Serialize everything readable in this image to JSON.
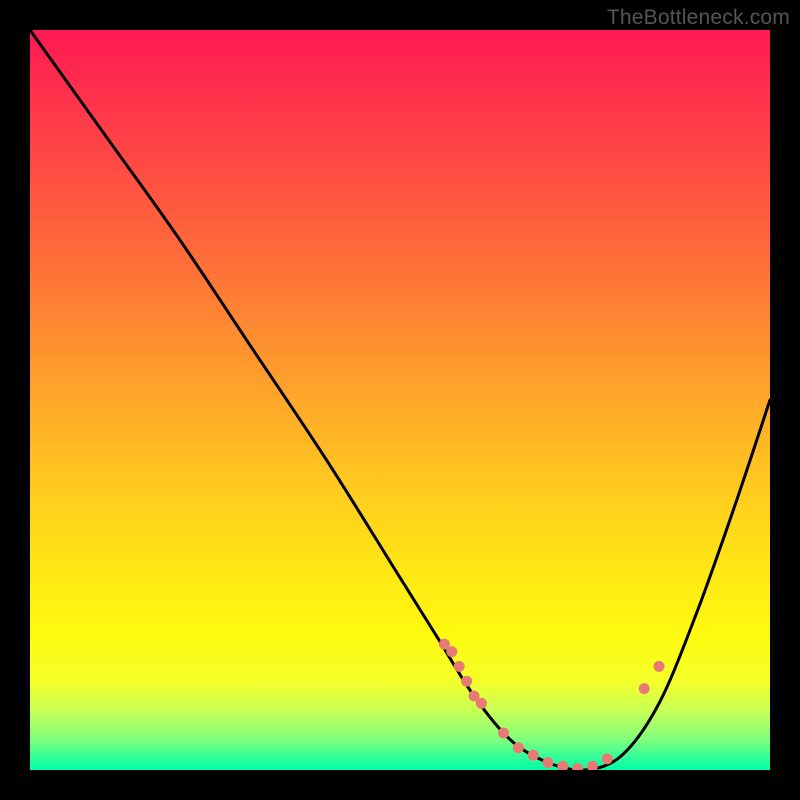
{
  "attribution": "TheBottleneck.com",
  "chart_data": {
    "type": "line",
    "title": "",
    "xlabel": "",
    "ylabel": "",
    "xlim": [
      0,
      100
    ],
    "ylim": [
      0,
      100
    ],
    "series": [
      {
        "name": "bottleneck-curve",
        "x": [
          0,
          10,
          20,
          30,
          40,
          50,
          55,
          60,
          65,
          70,
          75,
          80,
          85,
          90,
          95,
          100
        ],
        "values": [
          100,
          86,
          72,
          57,
          42,
          26,
          18,
          10,
          4,
          1,
          0,
          2,
          9,
          21,
          35,
          50
        ]
      }
    ],
    "markers": {
      "name": "highlight-dots",
      "x": [
        56,
        57,
        58,
        59,
        60,
        61,
        64,
        66,
        68,
        70,
        72,
        74,
        76,
        78,
        83,
        85
      ],
      "y": [
        17,
        16,
        14,
        12,
        10,
        9,
        5,
        3,
        2,
        1,
        0.5,
        0.2,
        0.5,
        1.5,
        11,
        14
      ]
    },
    "gradient_stops": [
      {
        "pos": 0,
        "color": "#ff1a53"
      },
      {
        "pos": 0.5,
        "color": "#ffd31c"
      },
      {
        "pos": 0.9,
        "color": "#f4ff2a"
      },
      {
        "pos": 1.0,
        "color": "#00ffa8"
      }
    ]
  }
}
